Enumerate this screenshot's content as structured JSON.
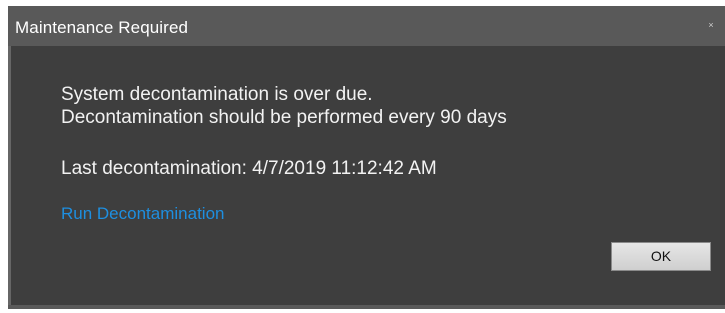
{
  "dialog": {
    "title": "Maintenance Required",
    "close_glyph": "×",
    "message_line1": "System decontamination is over due.",
    "message_line2": "Decontamination should be performed every 90 days",
    "last_decontamination": "Last decontamination: 4/7/2019 11:12:42 AM",
    "run_link_label": "Run Decontamination",
    "ok_label": "OK"
  },
  "colors": {
    "background": "#3e3e3e",
    "titlebar": "#595959",
    "link": "#1e8fe0",
    "text": "#f2f2f2"
  },
  "icons": {
    "close": "close-icon"
  }
}
